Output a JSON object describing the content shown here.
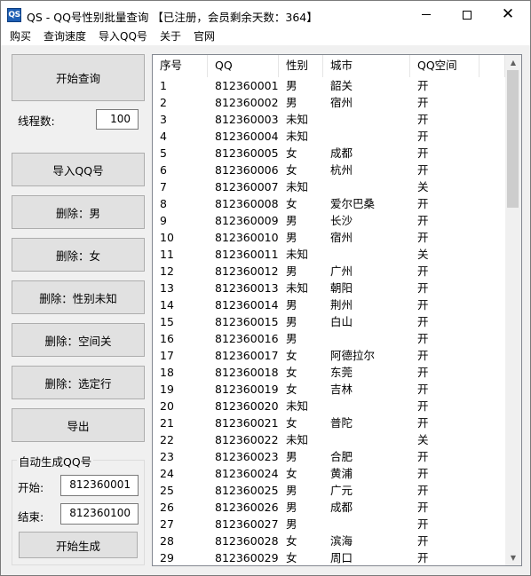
{
  "window": {
    "icon_text": "QS",
    "title": "QS - QQ号性别批量查询 【已注册，会员剩余天数：364】",
    "close_glyph": "✕"
  },
  "menu": [
    "购买",
    "查询速度",
    "导入QQ号",
    "关于",
    "官网"
  ],
  "left": {
    "start_query": "开始查询",
    "thread_label": "线程数:",
    "thread_value": "100",
    "import_qq": "导入QQ号",
    "del_male": "删除：男",
    "del_female": "删除：女",
    "del_unknown": "删除：性别未知",
    "del_space_off": "删除：空间关",
    "del_selected": "删除：选定行",
    "export": "导出",
    "group_title": "自动生成QQ号",
    "start_label": "开始:",
    "start_value": "812360001",
    "end_label": "结束:",
    "end_value": "812360100",
    "generate": "开始生成"
  },
  "table": {
    "columns": [
      "序号",
      "QQ",
      "性别",
      "城市",
      "QQ空间",
      ""
    ],
    "rows": [
      [
        "1",
        "812360001",
        "男",
        "韶关",
        "开"
      ],
      [
        "2",
        "812360002",
        "男",
        "宿州",
        "开"
      ],
      [
        "3",
        "812360003",
        "未知",
        "",
        "开"
      ],
      [
        "4",
        "812360004",
        "未知",
        "",
        "开"
      ],
      [
        "5",
        "812360005",
        "女",
        "成都",
        "开"
      ],
      [
        "6",
        "812360006",
        "女",
        "杭州",
        "开"
      ],
      [
        "7",
        "812360007",
        "未知",
        "",
        "关"
      ],
      [
        "8",
        "812360008",
        "女",
        "爱尔巴桑",
        "开"
      ],
      [
        "9",
        "812360009",
        "男",
        "长沙",
        "开"
      ],
      [
        "10",
        "812360010",
        "男",
        "宿州",
        "开"
      ],
      [
        "11",
        "812360011",
        "未知",
        "",
        "关"
      ],
      [
        "12",
        "812360012",
        "男",
        "广州",
        "开"
      ],
      [
        "13",
        "812360013",
        "未知",
        "朝阳",
        "开"
      ],
      [
        "14",
        "812360014",
        "男",
        "荆州",
        "开"
      ],
      [
        "15",
        "812360015",
        "男",
        "白山",
        "开"
      ],
      [
        "16",
        "812360016",
        "男",
        "",
        "开"
      ],
      [
        "17",
        "812360017",
        "女",
        "阿德拉尔",
        "开"
      ],
      [
        "18",
        "812360018",
        "女",
        "东莞",
        "开"
      ],
      [
        "19",
        "812360019",
        "女",
        "吉林",
        "开"
      ],
      [
        "20",
        "812360020",
        "未知",
        "",
        "开"
      ],
      [
        "21",
        "812360021",
        "女",
        "普陀",
        "开"
      ],
      [
        "22",
        "812360022",
        "未知",
        "",
        "关"
      ],
      [
        "23",
        "812360023",
        "男",
        "合肥",
        "开"
      ],
      [
        "24",
        "812360024",
        "女",
        "黄浦",
        "开"
      ],
      [
        "25",
        "812360025",
        "男",
        "广元",
        "开"
      ],
      [
        "26",
        "812360026",
        "男",
        "成都",
        "开"
      ],
      [
        "27",
        "812360027",
        "男",
        "",
        "开"
      ],
      [
        "28",
        "812360028",
        "女",
        "滨海",
        "开"
      ],
      [
        "29",
        "812360029",
        "女",
        "周口",
        "开"
      ]
    ]
  }
}
